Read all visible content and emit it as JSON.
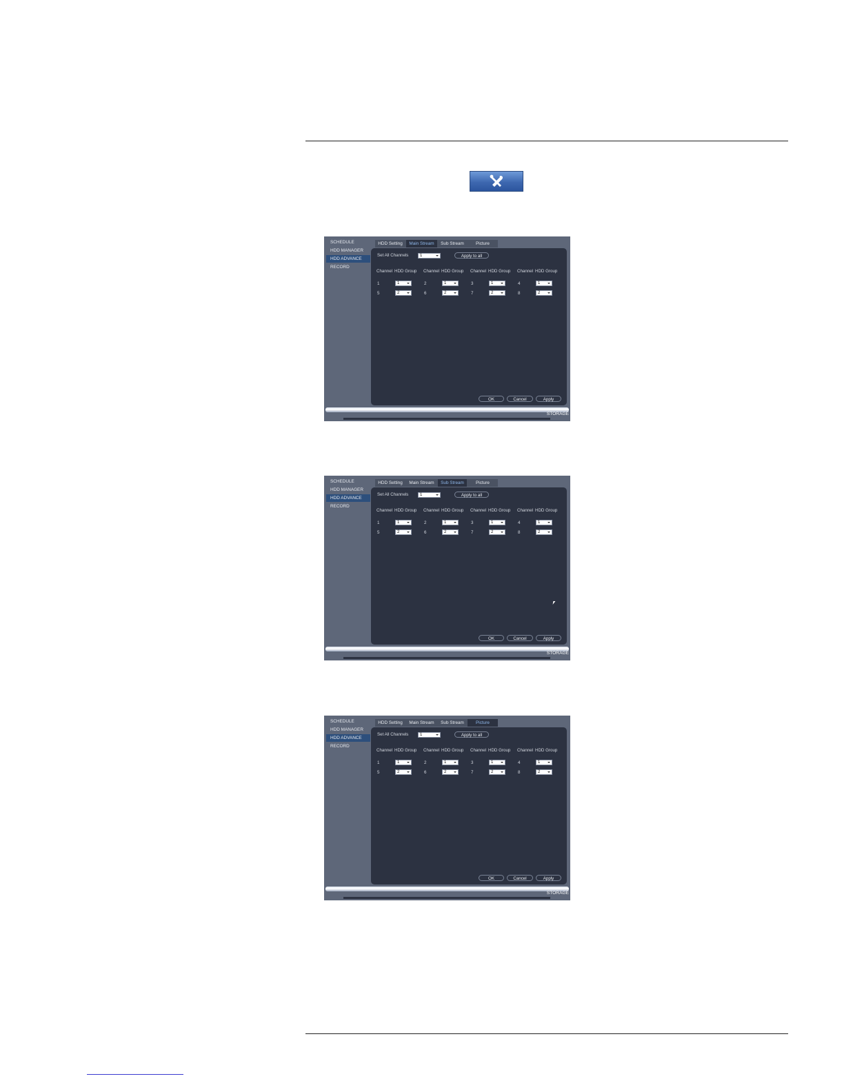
{
  "colors": {
    "panel_bg": "#2c3241",
    "frame_bg": "#5e6779",
    "active_tab_text": "#8fb8ea",
    "active_side_bg": "#2d4f7c",
    "tool_button": "#3e68b0"
  },
  "toolbar_icon": "tools-icon",
  "screens": [
    {
      "active_tab": 1,
      "sidebar": [
        "SCHEDULE",
        "HDD MANAGER",
        "HDD ADVANCE",
        "RECORD"
      ],
      "active_side": 2,
      "tabs": [
        "HDD Setting",
        "Main Stream",
        "Sub Stream",
        "Picture"
      ],
      "set_all_label": "Set All Channels",
      "set_all_value": "1",
      "apply_to_all": "Apply to all",
      "col_channel": "Channel",
      "col_group": "HDD Group",
      "rows": [
        [
          {
            "ch": "1",
            "g": "1"
          },
          {
            "ch": "2",
            "g": "1"
          },
          {
            "ch": "3",
            "g": "1"
          },
          {
            "ch": "4",
            "g": "1"
          }
        ],
        [
          {
            "ch": "5",
            "g": "2"
          },
          {
            "ch": "6",
            "g": "2"
          },
          {
            "ch": "7",
            "g": "2"
          },
          {
            "ch": "8",
            "g": "2"
          }
        ]
      ],
      "ok": "OK",
      "cancel": "Cancel",
      "apply": "Apply",
      "footer": "STORAGE"
    },
    {
      "active_tab": 2,
      "sidebar": [
        "SCHEDULE",
        "HDD MANAGER",
        "HDD ADVANCE",
        "RECORD"
      ],
      "active_side": 2,
      "tabs": [
        "HDD Setting",
        "Main Stream",
        "Sub Stream",
        "Picture"
      ],
      "set_all_label": "Set All Channels",
      "set_all_value": "1",
      "apply_to_all": "Apply to all",
      "col_channel": "Channel",
      "col_group": "HDD Group",
      "rows": [
        [
          {
            "ch": "1",
            "g": "1"
          },
          {
            "ch": "2",
            "g": "1"
          },
          {
            "ch": "3",
            "g": "1"
          },
          {
            "ch": "4",
            "g": "1"
          }
        ],
        [
          {
            "ch": "5",
            "g": "2"
          },
          {
            "ch": "6",
            "g": "2"
          },
          {
            "ch": "7",
            "g": "2"
          },
          {
            "ch": "8",
            "g": "2"
          }
        ]
      ],
      "ok": "OK",
      "cancel": "Cancel",
      "apply": "Apply",
      "footer": "STORAGE"
    },
    {
      "active_tab": 3,
      "sidebar": [
        "SCHEDULE",
        "HDD MANAGER",
        "HDD ADVANCE",
        "RECORD"
      ],
      "active_side": 2,
      "tabs": [
        "HDD Setting",
        "Main Stream",
        "Sub Stream",
        "Picture"
      ],
      "set_all_label": "Set All Channels",
      "set_all_value": "1",
      "apply_to_all": "Apply to all",
      "col_channel": "Channel",
      "col_group": "HDD Group",
      "rows": [
        [
          {
            "ch": "1",
            "g": "1"
          },
          {
            "ch": "2",
            "g": "1"
          },
          {
            "ch": "3",
            "g": "1"
          },
          {
            "ch": "4",
            "g": "1"
          }
        ],
        [
          {
            "ch": "5",
            "g": "2"
          },
          {
            "ch": "6",
            "g": "2"
          },
          {
            "ch": "7",
            "g": "2"
          },
          {
            "ch": "8",
            "g": "2"
          }
        ]
      ],
      "ok": "OK",
      "cancel": "Cancel",
      "apply": "Apply",
      "footer": "STORAGE"
    }
  ]
}
